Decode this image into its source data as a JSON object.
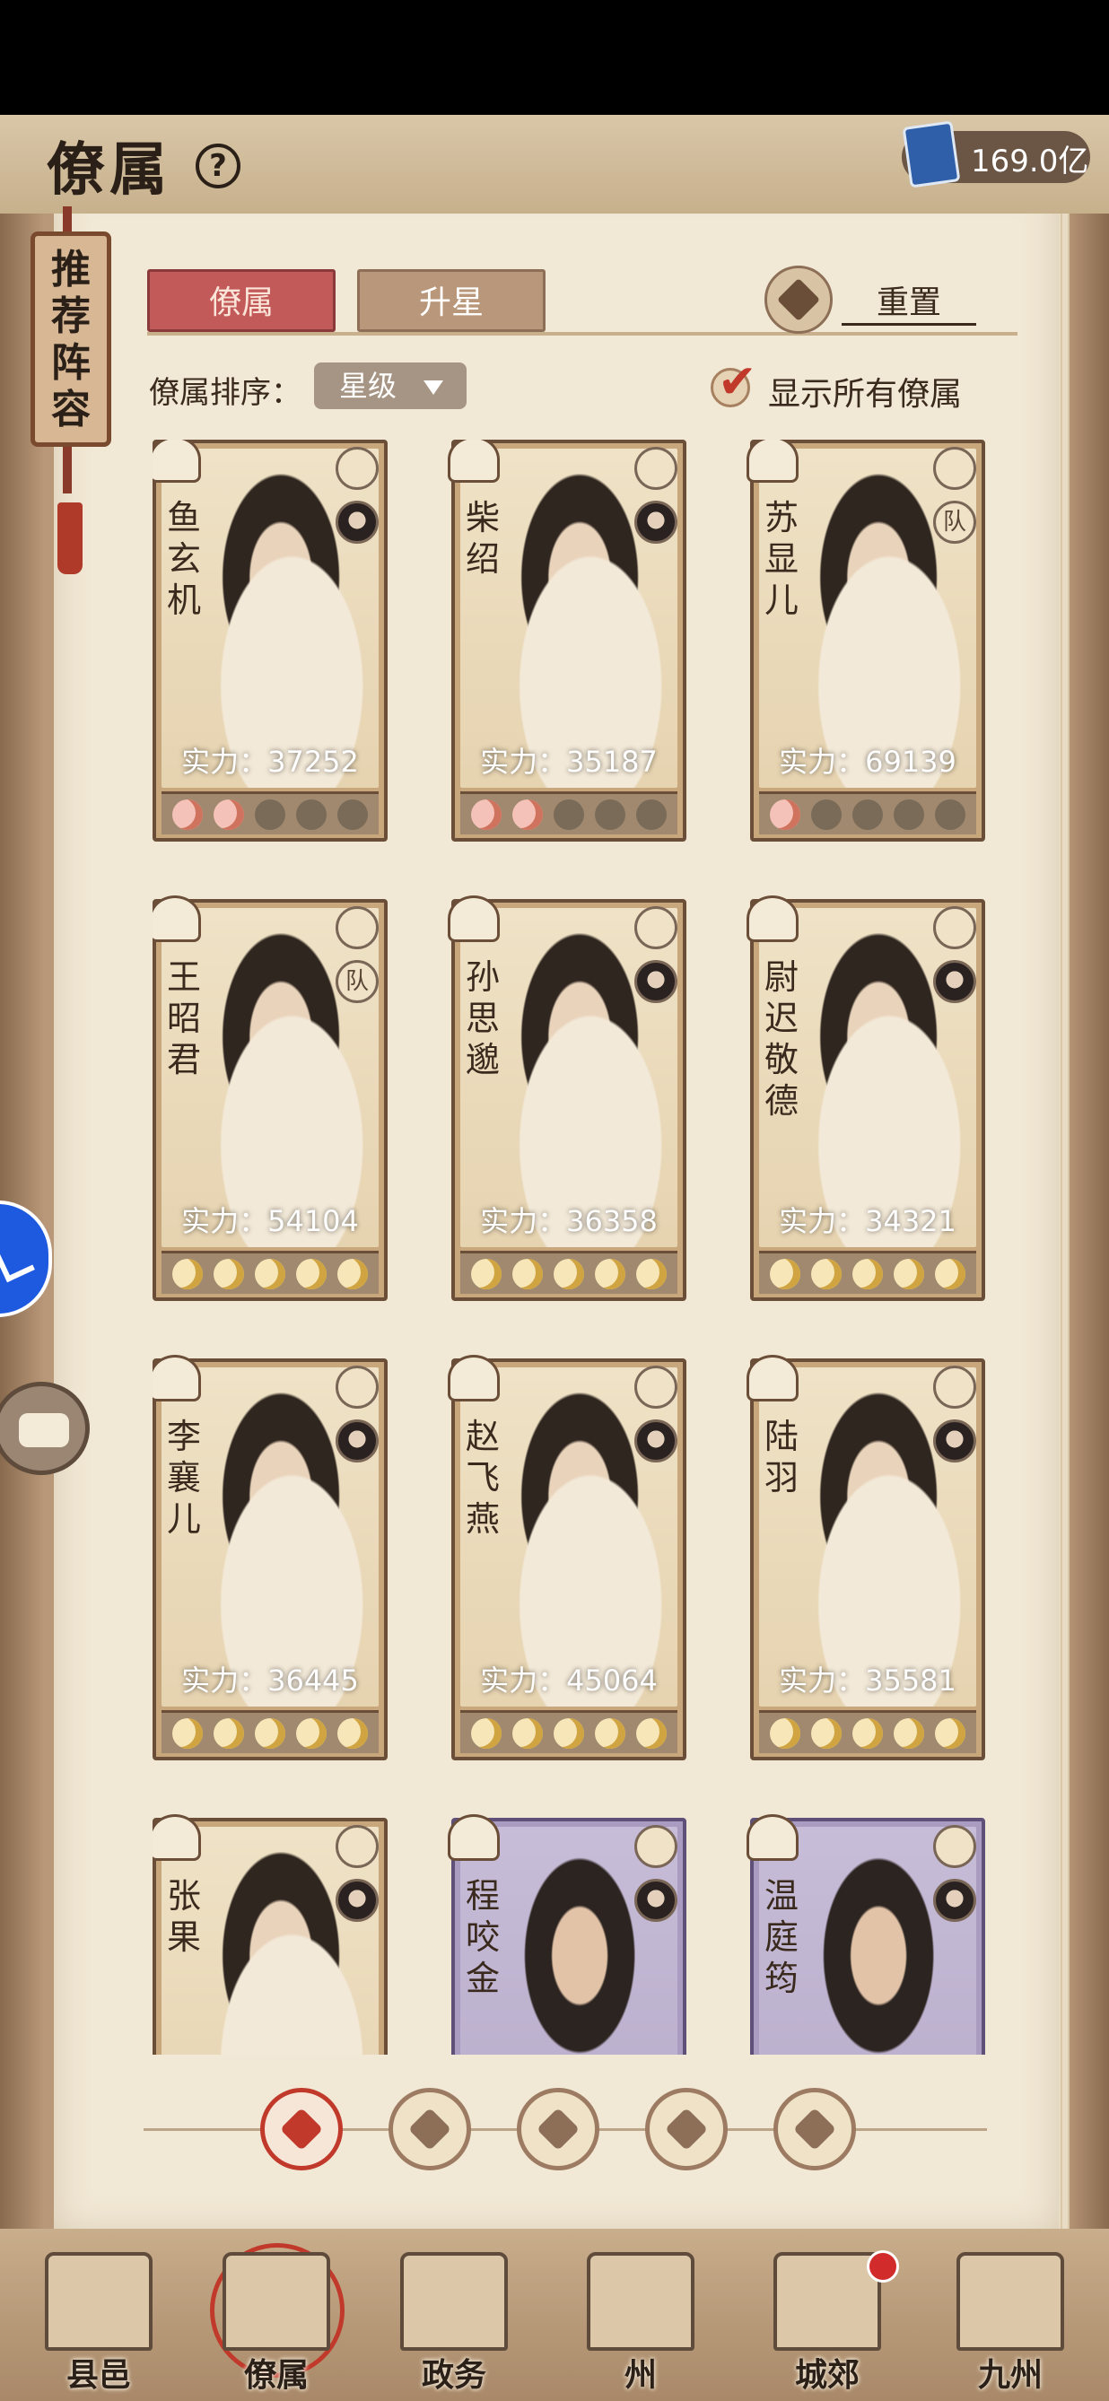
{
  "header": {
    "title": "僚属",
    "help_icon": "question-icon",
    "currency_value": "169.0亿",
    "currency_icon": "book-icon"
  },
  "banner": {
    "text": "推荐阵容"
  },
  "tabs": [
    {
      "label": "僚属",
      "active": true
    },
    {
      "label": "升星",
      "active": false
    }
  ],
  "reset": {
    "label": "重置",
    "icon": "reset-icon"
  },
  "sort": {
    "label": "僚属排序：",
    "value": "星级"
  },
  "show_all": {
    "label": "显示所有僚属",
    "checked": true
  },
  "cards": [
    {
      "name": "鱼玄机",
      "power": "实力：37252",
      "stars_filled": 2,
      "star_color": "red",
      "frame": "gold"
    },
    {
      "name": "柴绍",
      "power": "实力：35187",
      "stars_filled": 2,
      "star_color": "red",
      "frame": "gold"
    },
    {
      "name": "苏显儿",
      "power": "实力：69139",
      "stars_filled": 1,
      "star_color": "red",
      "frame": "gold",
      "team_badge": "队"
    },
    {
      "name": "王昭君",
      "power": "实力：54104",
      "stars_filled": 5,
      "star_color": "gold",
      "frame": "gold",
      "team_badge": "队"
    },
    {
      "name": "孙思邈",
      "power": "实力：36358",
      "stars_filled": 5,
      "star_color": "gold",
      "frame": "gold"
    },
    {
      "name": "尉迟敬德",
      "power": "实力：34321",
      "stars_filled": 5,
      "star_color": "gold",
      "frame": "gold"
    },
    {
      "name": "李襄儿",
      "power": "实力：36445",
      "stars_filled": 5,
      "star_color": "gold",
      "frame": "gold"
    },
    {
      "name": "赵飞燕",
      "power": "实力：45064",
      "stars_filled": 5,
      "star_color": "gold",
      "frame": "gold"
    },
    {
      "name": "陆羽",
      "power": "实力：35581",
      "stars_filled": 5,
      "star_color": "gold",
      "frame": "gold"
    },
    {
      "name": "张果",
      "power": "",
      "stars_filled": 0,
      "star_color": "gold",
      "frame": "gold"
    },
    {
      "name": "程咬金",
      "power": "",
      "stars_filled": 0,
      "star_color": "gold",
      "frame": "purple"
    },
    {
      "name": "温庭筠",
      "power": "",
      "stars_filled": 0,
      "star_color": "gold",
      "frame": "purple"
    }
  ],
  "filters": [
    {
      "icon": "all-icon",
      "active": true
    },
    {
      "icon": "scholar-icon",
      "active": false
    },
    {
      "icon": "gourd-icon",
      "active": false
    },
    {
      "icon": "fan-icon",
      "active": false
    },
    {
      "icon": "beast-icon",
      "active": false
    }
  ],
  "bottom_nav": [
    {
      "label": "县邑",
      "active": false
    },
    {
      "label": "僚属",
      "active": true
    },
    {
      "label": "政务",
      "active": false
    },
    {
      "label": "州",
      "active": false
    },
    {
      "label": "城郊",
      "active": false,
      "badge": true
    },
    {
      "label": "九州",
      "active": false
    }
  ],
  "colors": {
    "accent_red": "#c0392b",
    "tab_active": "#c25a5a",
    "parchment": "#f1e8d5"
  }
}
